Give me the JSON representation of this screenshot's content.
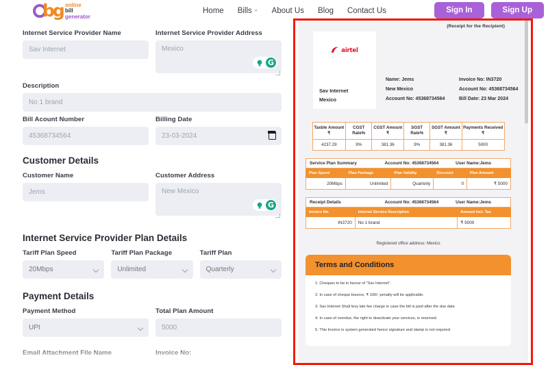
{
  "nav": {
    "logo": {
      "mark": "obg",
      "line1": "online",
      "line2": "bill",
      "line3": "generator"
    },
    "links": [
      {
        "label": "Home",
        "has_caret": false
      },
      {
        "label": "Bills",
        "has_caret": true
      },
      {
        "label": "About Us",
        "has_caret": false
      },
      {
        "label": "Blog",
        "has_caret": false
      },
      {
        "label": "Contact Us",
        "has_caret": false
      }
    ],
    "sign_in": "Sign In",
    "sign_up": "Sign Up",
    "accent_purple": "#A961D8"
  },
  "form": {
    "isp_name": {
      "label": "Internet Service Provider Name",
      "value": "Sav Internet"
    },
    "isp_address": {
      "label": "Internet Service Provider Address",
      "value": "Mexico"
    },
    "description": {
      "label": "Description",
      "value": "No 1 brand"
    },
    "bill_account_number": {
      "label": "Bill Acount Number",
      "value": "45368734564"
    },
    "billing_date": {
      "label": "Billing Date",
      "value": "23-03-2024"
    },
    "customer_section": "Customer Details",
    "customer_name": {
      "label": "Customer Name",
      "value": "Jems"
    },
    "customer_address": {
      "label": "Customer Address",
      "value": "New Mexico"
    },
    "plan_section": "Internet Service Provider Plan Details",
    "tariff_plan_speed": {
      "label": "Tariff Plan Speed",
      "value": "20Mbps"
    },
    "tariff_plan_package": {
      "label": "Tariff Plan Package",
      "value": "Unlimited"
    },
    "tariff_plan": {
      "label": "Tariff Plan",
      "value": "Quarterly"
    },
    "payment_section": "Payment Details",
    "payment_method": {
      "label": "Payment Method",
      "value": "UPI"
    },
    "total_plan_amount": {
      "label": "Total Plan Amount",
      "value": "5000"
    },
    "email_attachment": {
      "label": "Email Attachment File Name",
      "value": ""
    },
    "invoice_no": {
      "label": "Invoice No:",
      "value": ""
    },
    "grammarly_bulb_icon": "lightbulb-icon",
    "grammarly_icon": "G",
    "calendar_icon": "calendar-icon"
  },
  "invoice": {
    "receipt_note": "(Receipt for the Recipient)",
    "brand_logo": "airtel",
    "isp_name": "Sav Internet",
    "isp_city": "Mexico",
    "customer": {
      "name_label": "Name: Jems",
      "address": "New Mexico",
      "account": "Account No: 45368734564"
    },
    "meta": {
      "invoice_no": "Invoice No: IN3720",
      "account_no": "Account No: 45368734564",
      "bill_date": "Bill Date: 23 Mar 2024"
    },
    "tax_table": {
      "headers": [
        "Taxble Amount ₹",
        "CGST Rate%",
        "CGST Amount ₹",
        "SGST Rate%",
        "SGST Amount ₹",
        "Payments Received ₹"
      ],
      "row": [
        "4237.29",
        "9%",
        "381.36",
        "9%",
        "381.36",
        "5000"
      ]
    },
    "service_plan": {
      "bar_title": "Service Plan Summary",
      "bar_account": "Account No: 45368734564",
      "bar_user": "User Name:Jems",
      "headers": [
        "Plan Speed",
        "Plan Package",
        "Plan Validity",
        "Discount",
        "Plan Amount"
      ],
      "row": [
        "20Mbps",
        "Unlimited",
        "Quarterly",
        "0",
        "₹ 5000"
      ]
    },
    "receipt_details": {
      "bar_title": "Receipt Details",
      "bar_account": "Account No: 45368734564",
      "bar_user": "User Name:Jems",
      "headers": [
        "Invoice No.",
        "Internet Service Description",
        "Amount Incl. Tax"
      ],
      "row": [
        "IN3720",
        "No 1 brand",
        "₹ 5000"
      ]
    },
    "registered_office": "Registered office address: Mexico",
    "terms_title": "Terms and Conditions",
    "terms": [
      "1. Cheques to be in favour of \"Sav Internet\".",
      "2. In case of cheque bounce, ₹ 100/- penalty will be applicable.",
      "3. Sav Internet Shall levy late fee charge in case the bill is paid after the due date",
      "4. In case of overdue, the right to deactivate your services, is reserved.",
      "5. This Invoice is system generated hence signature and stamp is not required"
    ],
    "accent_orange": "#F2912E",
    "annotation_color": "#f41707"
  }
}
